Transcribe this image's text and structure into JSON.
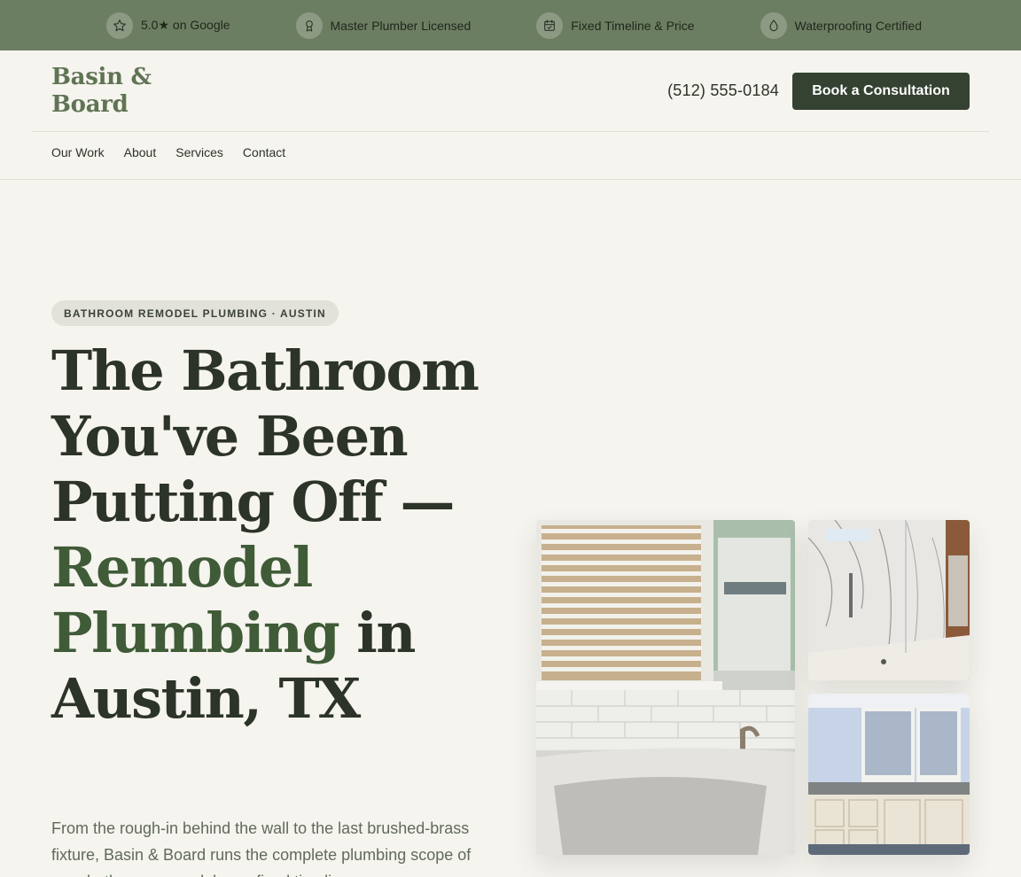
{
  "trust_bar": {
    "items": [
      {
        "icon": "star-icon",
        "label": "5.0★ on Google"
      },
      {
        "icon": "award-icon",
        "label": "Master Plumber Licensed"
      },
      {
        "icon": "calendar-check-icon",
        "label": "Fixed Timeline & Price"
      },
      {
        "icon": "droplet-icon",
        "label": "Waterproofing Certified"
      }
    ]
  },
  "header": {
    "logo_line1": "Basin &",
    "logo_line2": "Board",
    "phone": "(512) 555-0184",
    "cta_label": "Book a Consultation"
  },
  "nav": {
    "items": [
      "Our Work",
      "About",
      "Services",
      "Contact"
    ]
  },
  "hero": {
    "eyebrow": "BATHROOM REMODEL PLUMBING · AUSTIN",
    "headline_part1": "The Bathroom You've Been Putting Off —",
    "headline_accent": "Remodel Plumbing",
    "headline_part2": "in Austin, TX",
    "lede": "From the rough-in behind the wall to the last brushed-brass fixture, Basin & Board runs the complete plumbing scope of your bathroom remodel on a fixed timeline."
  },
  "colors": {
    "brand_green": "#6c7e61",
    "dark_green": "#354232",
    "accent_green": "#3f5b37",
    "background": "#f6f4ef"
  }
}
